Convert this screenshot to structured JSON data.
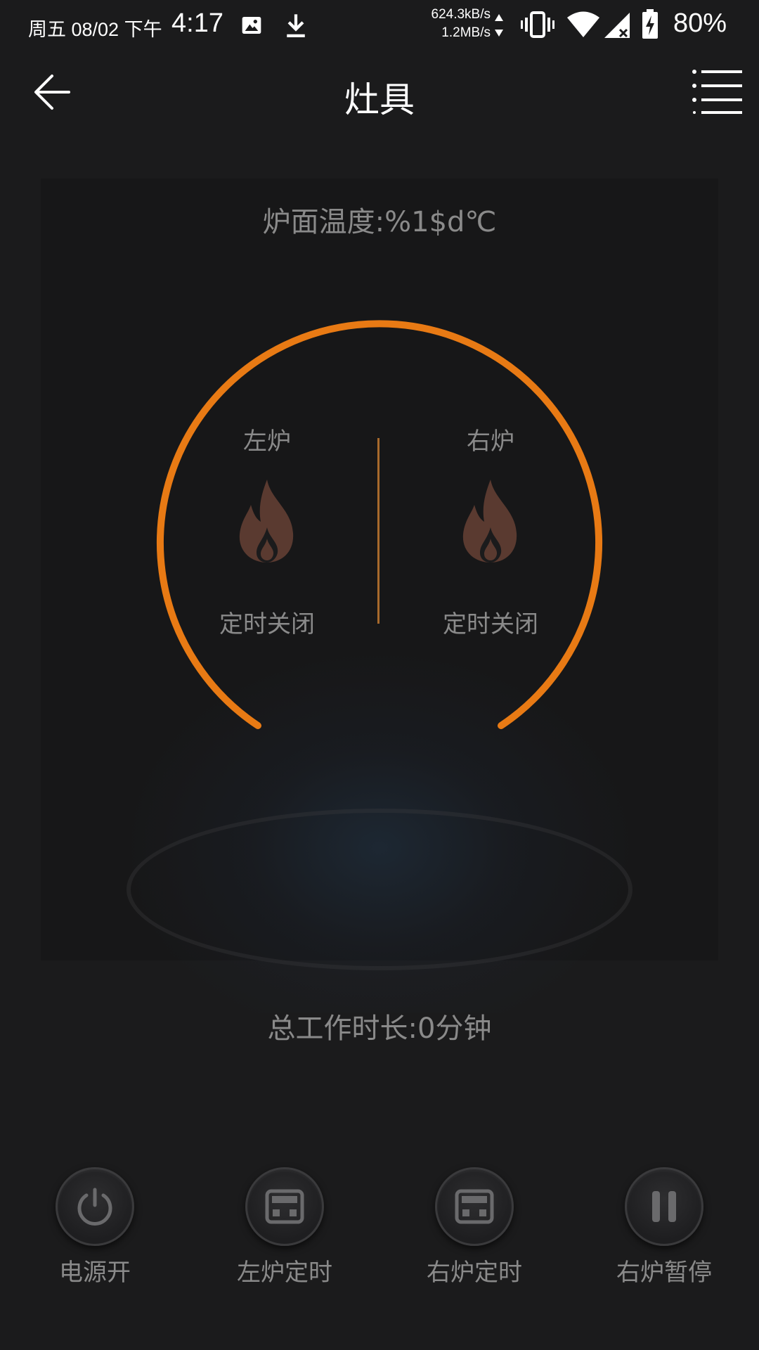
{
  "status_bar": {
    "date": "周五 08/02 下午",
    "time": "4:17",
    "speed_up": "624.3kB/s",
    "speed_down": "1.2MB/s",
    "battery": "80%",
    "icons": [
      "image-icon",
      "download-icon",
      "vibrate-icon",
      "wifi-icon",
      "no-signal-icon",
      "battery-charging-icon"
    ]
  },
  "header": {
    "title": "灶具",
    "back_icon": "arrow-left-icon",
    "menu_icon": "list-menu-icon"
  },
  "main": {
    "temperature": "炉面温度:%1$d℃",
    "left_burner": {
      "label": "左炉",
      "status": "定时关闭",
      "icon": "flame-icon"
    },
    "right_burner": {
      "label": "右炉",
      "status": "定时关闭",
      "icon": "flame-icon"
    },
    "total_time": "总工作时长:0分钟"
  },
  "controls": [
    {
      "label": "电源开",
      "icon": "power-icon"
    },
    {
      "label": "左炉定时",
      "icon": "timer-icon"
    },
    {
      "label": "右炉定时",
      "icon": "timer-icon"
    },
    {
      "label": "右炉暂停",
      "icon": "pause-icon"
    }
  ],
  "colors": {
    "background": "#1b1b1c",
    "accent": "#e87a14",
    "text_muted": "#8a8a8a",
    "flame": "#5a3a30"
  }
}
